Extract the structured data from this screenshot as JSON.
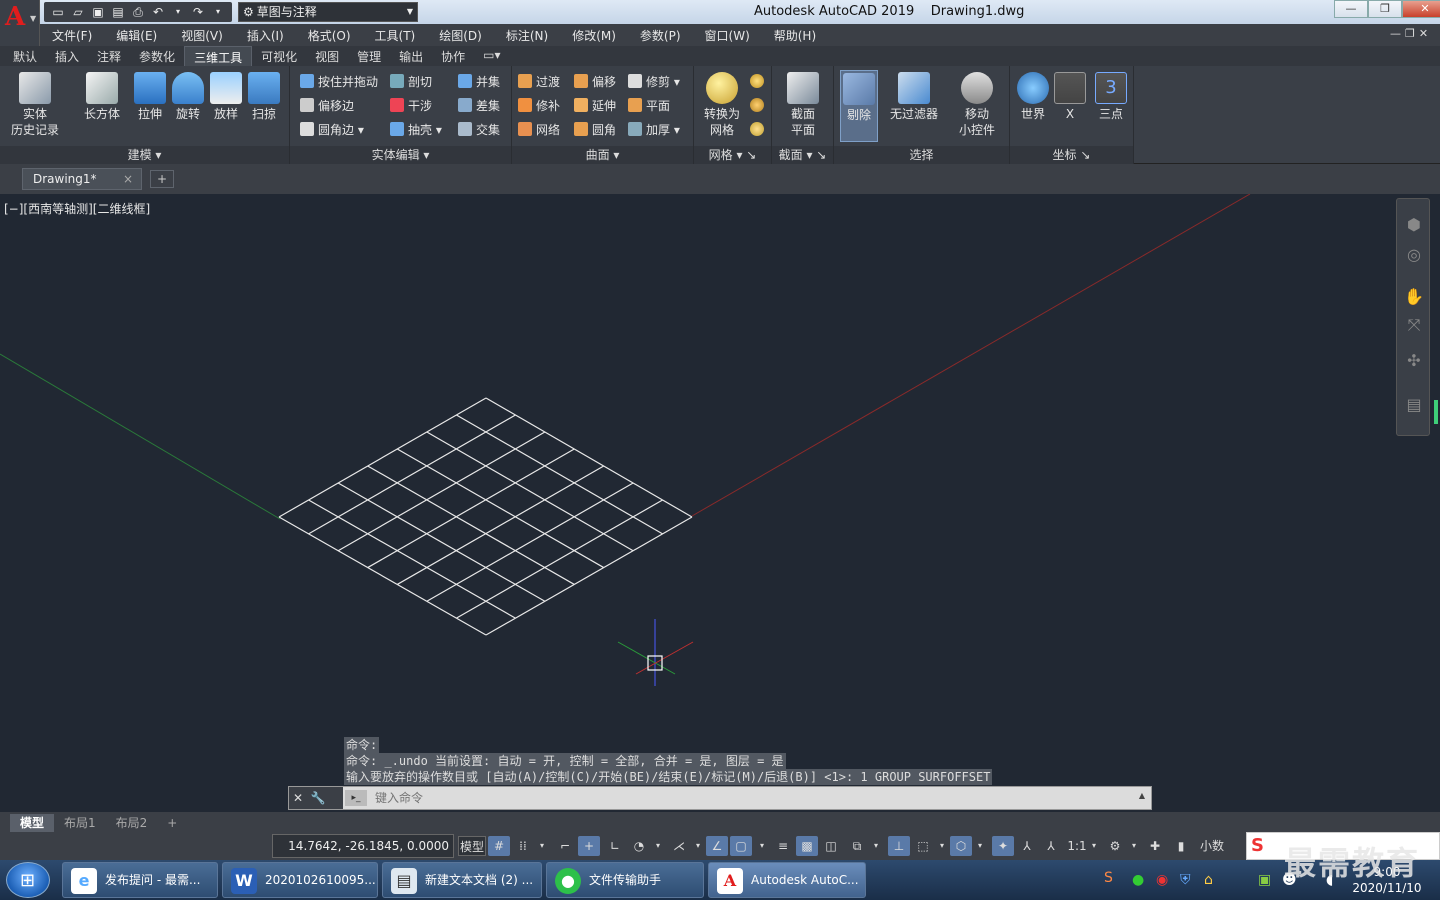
{
  "title": {
    "app": "Autodesk AutoCAD 2019",
    "doc": "Drawing1.dwg"
  },
  "qat": {
    "workspace": "草图与注释"
  },
  "menus": [
    "文件(F)",
    "编辑(E)",
    "视图(V)",
    "插入(I)",
    "格式(O)",
    "工具(T)",
    "绘图(D)",
    "标注(N)",
    "修改(M)",
    "参数(P)",
    "窗口(W)",
    "帮助(H)"
  ],
  "tabs": [
    "默认",
    "插入",
    "注释",
    "参数化",
    "三维工具",
    "可视化",
    "视图",
    "管理",
    "输出",
    "协作"
  ],
  "ribbon": {
    "modeling": {
      "label": "建模 ▾",
      "history": "实体\n历史记录",
      "box": "长方体",
      "extrude": "拉伸",
      "revolve": "旋转",
      "loft": "放样",
      "sweep": "扫掠"
    },
    "solidedit": {
      "label": "实体编辑 ▾",
      "presspull": "按住并拖动",
      "offsetedge": "偏移边",
      "filletedge": "圆角边 ▾",
      "slice": "剖切",
      "interfere": "干涉",
      "shell": "抽壳 ▾",
      "union": "并集",
      "subtract": "差集",
      "intersect": "交集"
    },
    "surface": {
      "label": "曲面 ▾",
      "blend": "过渡",
      "patch": "修补",
      "network": "网络",
      "offset": "偏移",
      "extend": "延伸",
      "fillet": "圆角",
      "trim": "修剪 ▾",
      "planar": "平面",
      "thicken": "加厚 ▾"
    },
    "mesh": {
      "label": "网格 ▾",
      "convert": "转换为\n网格"
    },
    "section": {
      "label": "截面 ▾",
      "plane": "截面\n平面"
    },
    "selection": {
      "label": "选择",
      "cull": "剔除",
      "nofilter": "无过滤器",
      "gizmo": "移动\n小控件"
    },
    "coords": {
      "label": "坐标",
      "world": "世界",
      "x": "X",
      "threepoint": "三点"
    }
  },
  "doctab": {
    "name": "Drawing1*",
    "close": "×",
    "new": "+"
  },
  "viewport": {
    "label": "[−][西南等轴测][二维线框]"
  },
  "command": {
    "history": [
      "命令:",
      "命令: _.undo 当前设置: 自动 = 开, 控制 = 全部, 合并 = 是, 图层 = 是",
      "输入要放弃的操作数目或 [自动(A)/控制(C)/开始(BE)/结束(E)/标记(M)/后退(B)] <1>: 1 GROUP SURFOFFSET"
    ],
    "placeholder": "键入命令"
  },
  "layouts": [
    "模型",
    "布局1",
    "布局2",
    "+"
  ],
  "status": {
    "coords": "14.7642, -26.1845, 0.0000",
    "model": "模型",
    "scale": "1:1",
    "units": "小数"
  },
  "taskbar": [
    {
      "label": "发布提问 - 最需...",
      "icon": "ie-icon"
    },
    {
      "label": "2020102610095...",
      "icon": "word-icon"
    },
    {
      "label": "新建文本文档 (2) ...",
      "icon": "notepad-icon"
    },
    {
      "label": "文件传输助手",
      "icon": "wechat-icon"
    },
    {
      "label": "Autodesk AutoC...",
      "icon": "autocad-icon"
    }
  ],
  "clock": {
    "time": "9:00",
    "date": "2020/11/10"
  },
  "watermark": "最需教育",
  "colors": {
    "accent": "#e11d1d",
    "viewport": "#212833",
    "ribbon": "#3a3f47",
    "selected": "#5a7aa8"
  }
}
